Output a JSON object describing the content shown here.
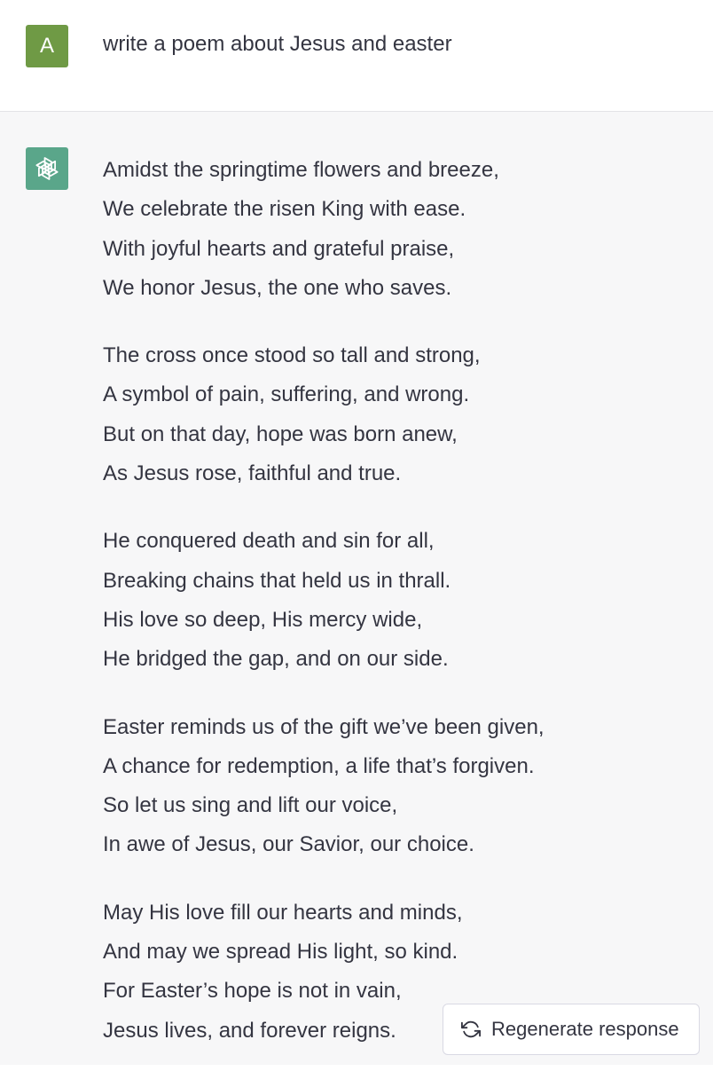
{
  "user_message": {
    "avatar_letter": "A",
    "text": "write a poem about Jesus and easter"
  },
  "assistant_message": {
    "avatar_icon": "openai-logo-icon",
    "stanzas": [
      {
        "lines": [
          "Amidst the springtime flowers and breeze,",
          "We celebrate the risen King with ease.",
          "With joyful hearts and grateful praise,",
          "We honor Jesus, the one who saves."
        ]
      },
      {
        "lines": [
          "The cross once stood so tall and strong,",
          "A symbol of pain, suffering, and wrong.",
          "But on that day, hope was born anew,",
          "As Jesus rose, faithful and true."
        ]
      },
      {
        "lines": [
          "He conquered death and sin for all,",
          "Breaking chains that held us in thrall.",
          "His love so deep, His mercy wide,",
          "He bridged the gap, and on our side."
        ]
      },
      {
        "lines": [
          "Easter reminds us of the gift we’ve been given,",
          "A chance for redemption, a life that’s forgiven.",
          "So let us sing and lift our voice,",
          "In awe of Jesus, our Savior, our choice."
        ]
      },
      {
        "lines": [
          "May His love fill our hearts and minds,",
          "And may we spread His light, so kind.",
          "For Easter’s hope is not in vain,",
          "Jesus lives, and forever reigns."
        ]
      }
    ]
  },
  "regenerate_button": {
    "icon": "refresh-icon",
    "label": "Regenerate response"
  },
  "colors": {
    "user_avatar": "#6f9a45",
    "assistant_avatar": "#5aa68a",
    "assistant_background": "#f7f7f8",
    "text": "#343541"
  }
}
